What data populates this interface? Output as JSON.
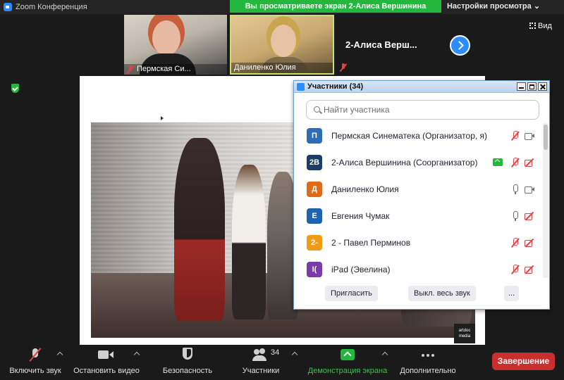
{
  "window": {
    "title": "Zoom Конференция"
  },
  "banner": {
    "sharing_text": "Вы просматриваете экран 2-Алиса Вершинина",
    "view_settings": "Настройки просмотра"
  },
  "videos": [
    {
      "name": "Пермская Си..."
    },
    {
      "name": "Даниленко Юлия"
    }
  ],
  "presenter_strip": {
    "name": "2-Алиса Верш...",
    "view_label": "Вид"
  },
  "shared_screen": {
    "watermark": "artdoc media"
  },
  "participants_panel": {
    "title": "Участники (34)",
    "search_placeholder": "Найти участника",
    "participants": [
      {
        "initials": "П",
        "color": "#2e6db5",
        "name": "Пермская Синематека (Организатор, я)",
        "mic": "muted",
        "camera": "on",
        "sharing": false
      },
      {
        "initials": "2В",
        "color": "#1b3e66",
        "name": "2-Алиса Вершинина (Соорганизатор)",
        "mic": "muted",
        "camera": "off",
        "sharing": true
      },
      {
        "initials": "Д",
        "color": "#e06a1b",
        "name": "Даниленко Юлия",
        "mic": "on",
        "camera": "on",
        "sharing": false
      },
      {
        "initials": "Е",
        "color": "#1e63b0",
        "name": "Евгения Чумак",
        "mic": "on",
        "camera": "off",
        "sharing": false
      },
      {
        "initials": "2-",
        "color": "#f09a1a",
        "name": "2 - Павел Перминов",
        "mic": "muted",
        "camera": "off",
        "sharing": false
      },
      {
        "initials": "I(",
        "color": "#7a3aa8",
        "name": "iPad (Эвелина)",
        "mic": "muted",
        "camera": "off",
        "sharing": false
      }
    ],
    "buttons": {
      "invite": "Пригласить",
      "mute_all": "Выкл. весь звук",
      "more": "..."
    }
  },
  "toolbar": {
    "unmute": "Включить звук",
    "start_video": "Остановить видео",
    "security": "Безопасность",
    "participants": "Участники",
    "participants_count": "34",
    "share_screen": "Демонстрация экрана",
    "more": "Дополнительно",
    "end": "Завершение"
  },
  "colors": {
    "accent_blue": "#2d8cff",
    "share_green": "#23b83d",
    "end_red": "#c7302f",
    "muted_red": "#e04343"
  },
  "icons": [
    "zoom-logo-icon",
    "mic-off-icon",
    "camera-icon",
    "shield-icon",
    "participants-icon",
    "share-screen-icon",
    "more-icon",
    "search-icon",
    "next-arrow-icon",
    "grid-view-icon"
  ]
}
